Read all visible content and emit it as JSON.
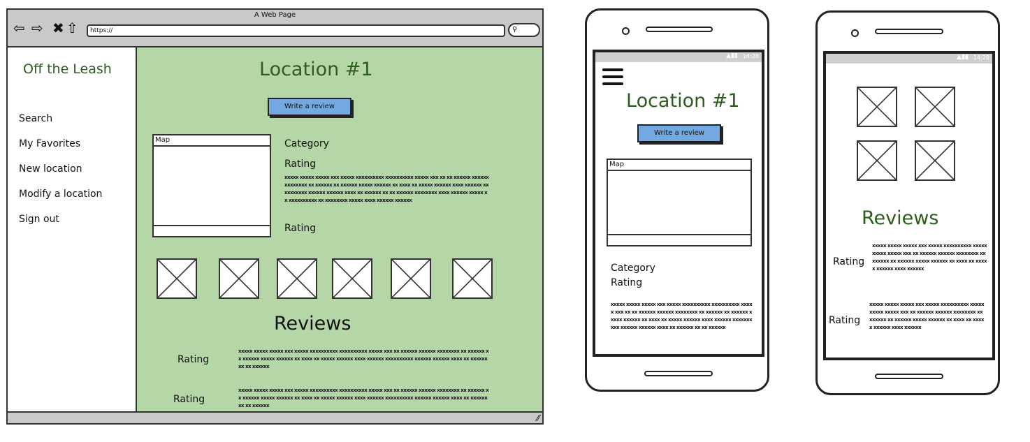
{
  "browser": {
    "title": "A Web Page",
    "url": "https://",
    "nav_icons": [
      "back-arrow-icon",
      "forward-arrow-icon",
      "close-icon",
      "home-icon"
    ],
    "accent_bg": "#b5d7a8"
  },
  "sidebar": {
    "logo": "Off the Leash",
    "items": [
      {
        "label": "Search"
      },
      {
        "label": "My Favorites"
      },
      {
        "label": "New location"
      },
      {
        "label": "Modify a location"
      },
      {
        "label": "Sign out"
      }
    ]
  },
  "main": {
    "title": "Location #1",
    "write_review_label": "Write a review",
    "map_label": "Map",
    "category_label": "Category",
    "rating_label": "Rating",
    "rating_label_2": "Rating",
    "description": "xxxxx xxxxx xxxxx xxx xxxxx xxxxxxxxxx xxxxxxxxxx xxxxx xxx xx xx xxxxxx xxxxxx xxxxxxxx xx xxxxxx xx xxxxxx xxxxx xxxxxx xx xxxx xx xxxxx xxxxxx xxxx xxxxxx xxxxxxxxxx xxxxxx xxxxxx xxxx xx xxxxxx xx xx xxxxxx xxxxxxxx xxxx xxxxxx xxxxx xx xxxxxxxxxx xx xxxxxxxx xxxxx xxxx xxxxxx xxxxxx",
    "image_count": 6,
    "reviews_title": "Reviews",
    "reviews": [
      {
        "rating_label": "Rating",
        "text": "xxxxx xxxxx xxxxx xxx xxxxx xxxxxxxxxx xxxxxxxxxx xxxxx xxx xx xxxxxx xxxxxx xxxxxxxx xx xxxxxx xx xxxxxx xxxxx xxxxxx xx xxxx xx xxxxx xxxxxx xxxx xxxxxx xxxxxxxxxx xxxxxx xxxxxx xxxx xx xxxxxx xx xx xxxxxx"
      },
      {
        "rating_label": "Rating",
        "text": "xxxxx xxxxx xxxxx xxx xxxxx xxxxxxxxxx xxxxxxxxxx xxxxx xxx xx xxxxxx xxxxxx xxxxxxxx xx xxxxxx xx xxxxxx xxxxx xxxxxx xx xxxx xx xxxxx xxxxxx xxxx xxxxxx xxxxxxxxxx xxxxxx xxxxxx xxxx xx xxxxxx xx xx xxxxxx"
      }
    ]
  },
  "phone1": {
    "status_time": "14:28",
    "title": "Location #1",
    "write_review_label": "Write a review",
    "map_label": "Map",
    "category_label": "Category",
    "rating_label": "Rating",
    "description": "xxxxx xxxxx xxxxx xxx xxxxx xxxxxxxxxx xxxxxxxxxx xxxxx xxx xx xx xxxxxx xxxxxx xxxxxxxx xx xxxxxx xx xxxxxx xxxxx xxxxxx xx xxxx xx xxxxx xxxxxx xxxx xxxxxx xxxxxxxxxx xxxxxx xxxxxx xxxx xx xxxxxx xx xx xxxxxx"
  },
  "phone2": {
    "status_time": "14:28",
    "image_count": 4,
    "reviews_title": "Reviews",
    "reviews": [
      {
        "rating_label": "Rating",
        "text": "xxxxx xxxxx xxxxx xxx xxxxx xxxxxxxxxx xxxxxxxxxx xxxxx xxx xx xxxxxx xxxxxx xxxxxxxx xx xxxxxx xx xxxxxx xxxxx xxxxxx xx xxxx xx xxxxx xxxxxx xxxx xxxxxx"
      },
      {
        "rating_label": "Rating",
        "text": "xxxxx xxxxx xxxxx xxx xxxxx xxxxxxxxxx xxxxxxxxxx xxxxx xxx xx xxxxxx xxxxxx xxxxxxxx xx xxxxxx xx xxxxxx xxxxx xxxxxx xx xxxx xx xxxxx xxxxxx xxxx xxxxxx"
      }
    ]
  },
  "colors": {
    "title_green": "#2b5d1d",
    "button_blue": "#74a8e0",
    "chrome_gray": "#c9c9c9"
  }
}
